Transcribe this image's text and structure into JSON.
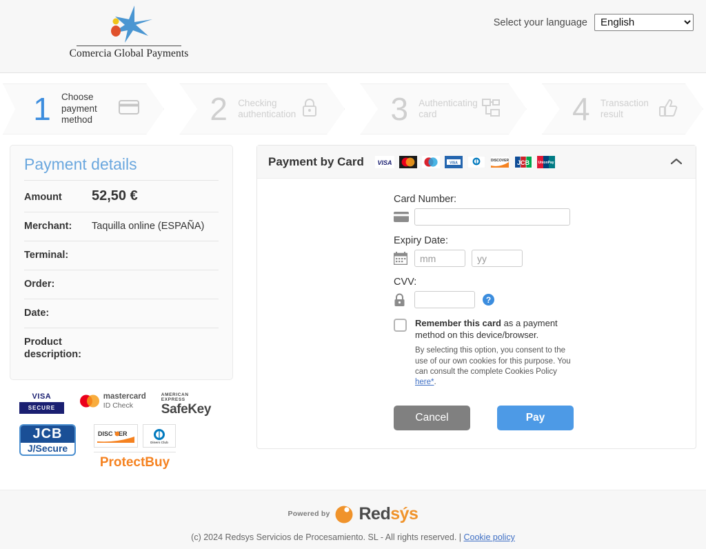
{
  "header": {
    "logo_text": "Comercia Global Payments",
    "logo_icon": "caixabank-star-icon",
    "language_label": "Select your language",
    "language_selected": "English",
    "language_options": [
      "English"
    ]
  },
  "steps": [
    {
      "number": "1",
      "label": "Choose payment method",
      "icon": "credit-card-icon",
      "active": true
    },
    {
      "number": "2",
      "label": "Checking authentication",
      "icon": "lock-icon",
      "active": false
    },
    {
      "number": "3",
      "label": "Authenticating card",
      "icon": "network-nodes-icon",
      "active": false
    },
    {
      "number": "4",
      "label": "Transaction result",
      "icon": "thumbs-up-icon",
      "active": false
    }
  ],
  "payment_details": {
    "title": "Payment details",
    "rows": [
      {
        "label": "Amount",
        "value": "52,50 €"
      },
      {
        "label": "Merchant:",
        "value": "Taquilla online (ESPAÑA)"
      },
      {
        "label": "Terminal:",
        "value": ""
      },
      {
        "label": "Order:",
        "value": ""
      },
      {
        "label": "Date:",
        "value": ""
      },
      {
        "label": "Product description:",
        "value": ""
      }
    ]
  },
  "security_badges": [
    {
      "name": "visa-secure-badge",
      "line1": "VISA",
      "line2": "SECURE"
    },
    {
      "name": "mastercard-id-check-badge",
      "line1": "mastercard",
      "line2": "ID Check"
    },
    {
      "name": "amex-safekey-badge",
      "line1": "AMERICAN EXPRESS",
      "line2": "SafeKey"
    },
    {
      "name": "jcb-jsecure-badge",
      "line1": "JCB",
      "line2": "J/Secure"
    },
    {
      "name": "protectbuy-badge",
      "line1": "DISC VER",
      "line2": "ProtectBuy"
    }
  ],
  "card_panel": {
    "title": "Payment by Card",
    "collapse_icon": "chevron-up-icon",
    "brands": [
      "VISA",
      "Mastercard",
      "Maestro",
      "Visa Electron",
      "Diners Club",
      "Discover",
      "JCB",
      "UnionPay"
    ],
    "card_number": {
      "label": "Card Number:",
      "value": "",
      "placeholder": "",
      "icon": "credit-card-icon"
    },
    "expiry": {
      "label": "Expiry Date:",
      "icon": "calendar-icon",
      "month_value": "",
      "month_placeholder": "mm",
      "year_value": "",
      "year_placeholder": "yy"
    },
    "cvv": {
      "label": "CVV:",
      "value": "",
      "placeholder": "",
      "icon": "padlock-icon",
      "help_icon": "question-mark-icon",
      "help_glyph": "?"
    },
    "remember": {
      "checked": false,
      "strong_text": "Remember this card",
      "rest_text": " as a payment method on this device/browser.",
      "consent_text": "By selecting this option, you consent to the use of our own cookies for this purpose. You can consult the complete Cookies Policy ",
      "consent_link": "here*",
      "consent_tail": "."
    },
    "cancel_label": "Cancel",
    "pay_label": "Pay"
  },
  "footer": {
    "powered_by": "Powered by",
    "brand_red": "Red",
    "brand_sys": "sýs",
    "copyright": "(c) 2024 Redsys Servicios de Procesamiento. SL - All rights reserved. | ",
    "cookie_link": "Cookie policy"
  },
  "colors": {
    "accent_blue": "#3c8dde",
    "pay_blue": "#4d9ae6",
    "cancel_gray": "#808080",
    "title_blue": "#6aa7de",
    "redsys_orange": "#f0932b"
  }
}
